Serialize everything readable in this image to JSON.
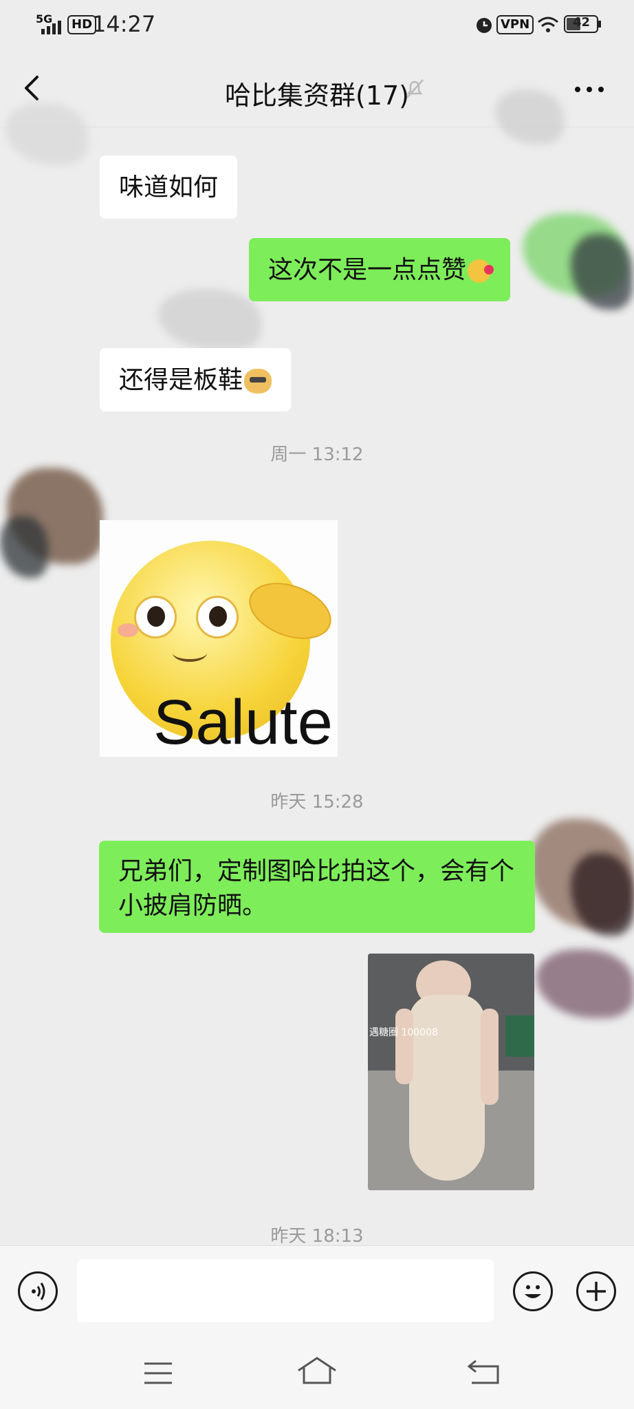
{
  "status_bar": {
    "network": "5G",
    "hd": "HD",
    "time": "14:27",
    "vpn": "VPN",
    "battery": "42"
  },
  "header": {
    "title": "哈比集资群(17)",
    "icons": [
      "back-icon",
      "mute-icon",
      "more-icon"
    ]
  },
  "messages": [
    {
      "side": "left",
      "text": "味道如何"
    },
    {
      "side": "right",
      "text": "这次不是一点点赞"
    },
    {
      "side": "left",
      "text": "还得是板鞋"
    },
    {
      "time": "周一 13:12"
    },
    {
      "side": "left",
      "type": "sticker",
      "text": "Salute"
    },
    {
      "time": "昨天 15:28"
    },
    {
      "side": "right",
      "text": "兄弟们，定制图哈比拍这个，会有个小披肩防晒。"
    },
    {
      "side": "right",
      "type": "image",
      "watermark": "遇糖圈 100008"
    },
    {
      "time": "昨天 18:13"
    }
  ],
  "input": {
    "placeholder": ""
  },
  "colors": {
    "bg": "#ededed",
    "green_bubble": "#7ded5a",
    "white_bubble": "#ffffff"
  }
}
